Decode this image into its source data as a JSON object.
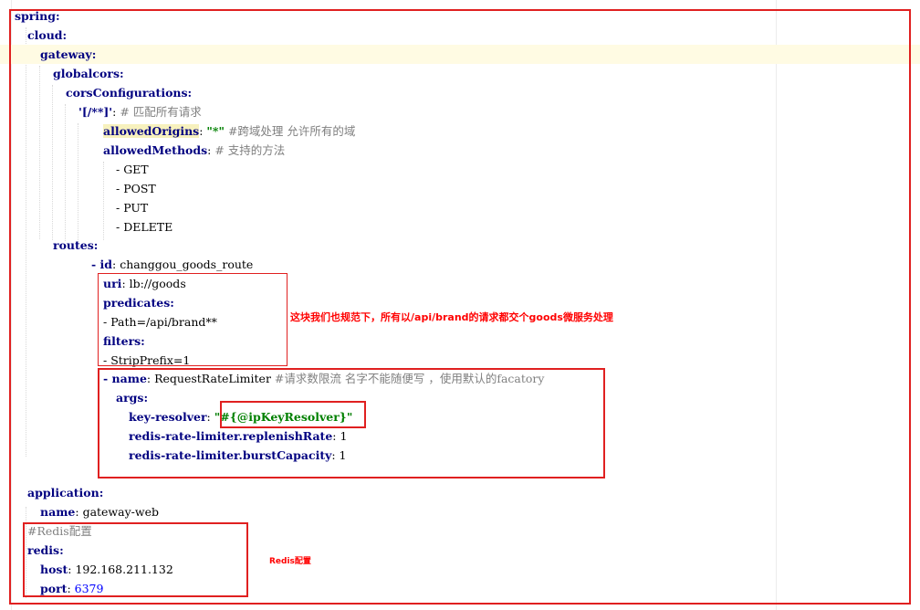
{
  "code": {
    "l1": {
      "k": "spring:"
    },
    "l2": {
      "k": "cloud:"
    },
    "l3": {
      "k": "gateway:"
    },
    "l4": {
      "k": "globalcors:"
    },
    "l5": {
      "k": "corsConfigurations:"
    },
    "l6": {
      "k": "'[/**]'",
      "p": ": ",
      "c": "# 匹配所有请求"
    },
    "l7": {
      "k": "allowedOrigins",
      "p": ": ",
      "s": "\"*\"",
      "c": " #跨域处理 允许所有的域"
    },
    "l8": {
      "k": "allowedMethods",
      "p": ": ",
      "c": "# 支持的方法"
    },
    "l9": {
      "v": "- GET"
    },
    "l10": {
      "v": "- POST"
    },
    "l11": {
      "v": "- PUT"
    },
    "l12": {
      "v": "- DELETE"
    },
    "l13": {
      "k": "routes:"
    },
    "l14": {
      "d": "- ",
      "k": "id",
      "p": ": ",
      "v": "changgou_goods_route"
    },
    "l15": {
      "k": "uri",
      "p": ": ",
      "v": "lb://goods"
    },
    "l16": {
      "k": "predicates:"
    },
    "l17": {
      "v": "- Path=/api/brand**"
    },
    "l18": {
      "k": "filters:"
    },
    "l19": {
      "v": "- StripPrefix=1"
    },
    "l20": {
      "d": "- ",
      "k": "name",
      "p": ": ",
      "v": "RequestRateLimiter ",
      "c": "#请求数限流 名字不能随便写 ，使用默认的facatory"
    },
    "l21": {
      "k": "args:"
    },
    "l22": {
      "k": "key-resolver",
      "p": ": ",
      "s": "\"#{@ipKeyResolver}\""
    },
    "l23": {
      "k": "redis-rate-limiter.replenishRate",
      "p": ": ",
      "v": "1"
    },
    "l24": {
      "k": "redis-rate-limiter.burstCapacity",
      "p": ": ",
      "v": "1"
    },
    "l25": {
      "k": "application:"
    },
    "l26": {
      "k": "name",
      "p": ": ",
      "v": "gateway-web"
    },
    "l27": {
      "c": "#Redis配置"
    },
    "l28": {
      "k": "redis:"
    },
    "l29": {
      "k": "host",
      "p": ": ",
      "v": "192.168.211.132"
    },
    "l30": {
      "k": "port",
      "p": ": ",
      "n": "6379"
    }
  },
  "annotations": {
    "goods_route": "这块我们也规范下，所有以/api/brand的请求都交个goods微服务处理",
    "redis": "Redis配置"
  },
  "colors": {
    "key": "#000080",
    "comment": "#808080",
    "string": "#008000",
    "number": "#0000ff",
    "annotation": "#ff0000",
    "current_line": "#fffbe3"
  }
}
